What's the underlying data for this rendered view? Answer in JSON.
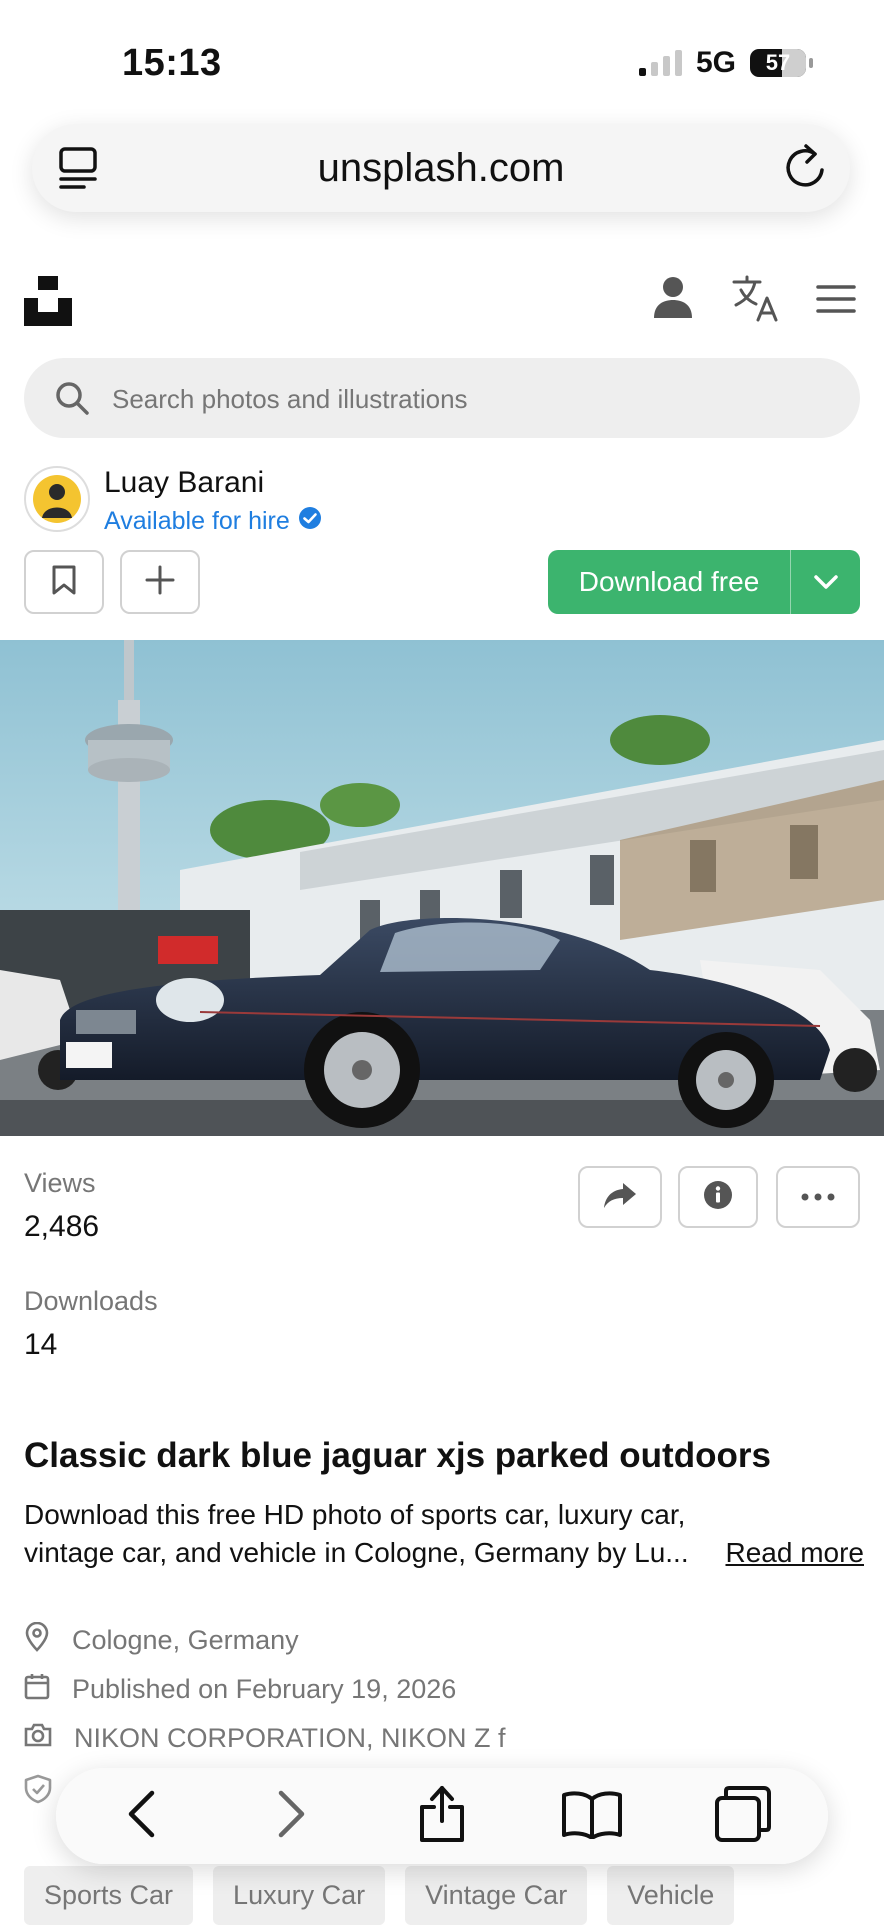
{
  "status": {
    "time": "15:13",
    "network": "5G",
    "battery": "57"
  },
  "browser": {
    "url": "unsplash.com"
  },
  "search": {
    "placeholder": "Search photos and illustrations"
  },
  "author": {
    "name": "Luay Barani",
    "hire_label": "Available for hire"
  },
  "actions": {
    "download_label": "Download free"
  },
  "stats": {
    "views_label": "Views",
    "views": "2,486",
    "downloads_label": "Downloads",
    "downloads": "14"
  },
  "photo_title": "Classic dark blue jaguar xjs parked outdoors",
  "description": {
    "line1": "Download this free HD photo of sports car, luxury car,",
    "line2": "vintage car, and vehicle in Cologne, Germany by Lu...",
    "read_more": "Read more"
  },
  "meta": {
    "location": "Cologne, Germany",
    "published": "Published on February 19, 2026",
    "camera": "NIKON CORPORATION, NIKON Z f"
  },
  "tags": [
    "Sports Car",
    "Luxury Car",
    "Vintage Car",
    "Vehicle"
  ],
  "colors": {
    "accent": "#3cb46e",
    "link": "#1f7ee0",
    "muted": "#767676"
  },
  "icons": [
    "reader-icon",
    "reload-icon",
    "unsplash-logo",
    "user-icon",
    "translate-icon",
    "menu-icon",
    "search-icon",
    "verified-icon",
    "bookmark-icon",
    "plus-icon",
    "chevron-down-icon",
    "share-icon",
    "info-icon",
    "more-icon",
    "location-icon",
    "calendar-icon",
    "camera-icon",
    "shield-icon",
    "back-icon",
    "forward-icon",
    "share-sheet-icon",
    "bookmarks-icon",
    "tabs-icon"
  ]
}
